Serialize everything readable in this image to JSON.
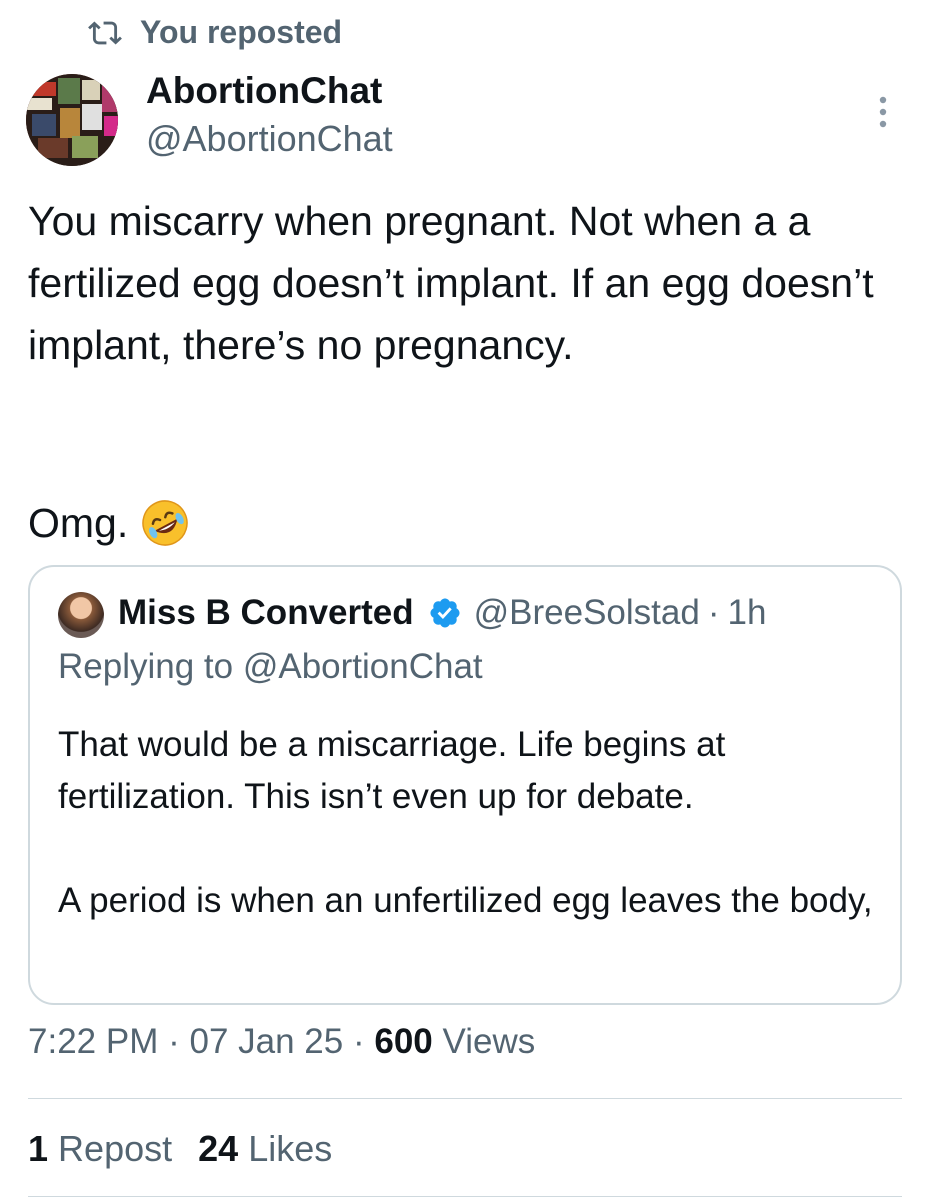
{
  "repost_banner": {
    "label": "You reposted",
    "icon": "repost-icon"
  },
  "author": {
    "display_name": "AbortionChat",
    "handle": "@AbortionChat"
  },
  "tweet": {
    "text": "You miscarry when pregnant. Not when a a fertilized egg doesn’t implant. If an egg doesn’t implant, there’s no pregnancy.",
    "closing": "Omg.",
    "emoji": "rolling-on-floor-laughing"
  },
  "quoted": {
    "display_name": "Miss B Converted",
    "handle": "@BreeSolstad",
    "separator": "·",
    "time": "1h",
    "replying_to": "Replying to @AbortionChat",
    "paragraph_1": "That would be a miscarriage. Life begins at fertilization. This isn’t even up for debate.",
    "paragraph_2": "A period is when an unfertilized egg leaves the body,"
  },
  "meta": {
    "time": "7:22 PM",
    "sep": "·",
    "date": "07 Jan 25",
    "views_count": "600",
    "views_label": "Views"
  },
  "stats": {
    "reposts_count": "1",
    "reposts_label": "Repost",
    "likes_count": "24",
    "likes_label": "Likes"
  },
  "colors": {
    "primary_text": "#0f1419",
    "secondary_text": "#536471",
    "border": "#cfd9de",
    "verified_blue": "#1d9bf0"
  }
}
